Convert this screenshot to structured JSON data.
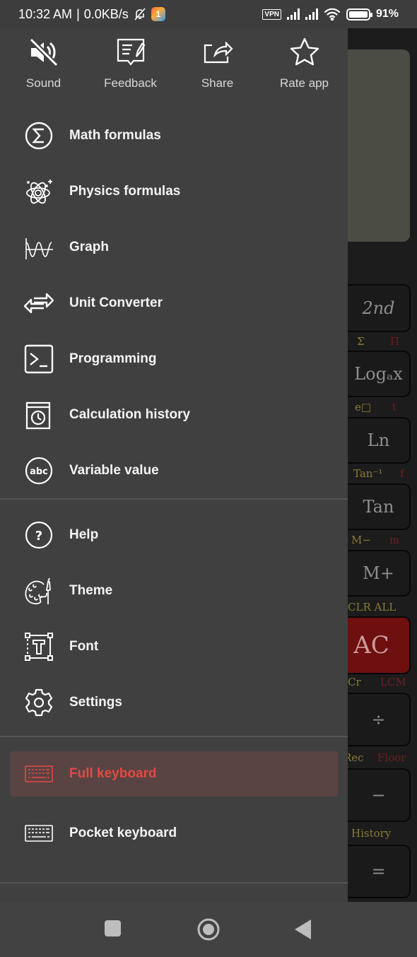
{
  "status_bar": {
    "time": "10:32 AM",
    "separator": "|",
    "network_speed": "0.0KB/s",
    "vpn_label": "VPN",
    "app_badge": "1",
    "battery": "91%",
    "icons": [
      "bell-off-icon",
      "app-notification-icon",
      "vpn-icon",
      "signal-icon",
      "signal-icon",
      "wifi-icon",
      "battery-icon"
    ]
  },
  "quick_actions": [
    {
      "label": "Sound",
      "icon": "sound-off-icon"
    },
    {
      "label": "Feedback",
      "icon": "feedback-icon"
    },
    {
      "label": "Share",
      "icon": "share-icon"
    },
    {
      "label": "Rate app",
      "icon": "star-icon"
    }
  ],
  "menu": {
    "tools": [
      {
        "label": "Math formulas",
        "icon": "sigma-icon"
      },
      {
        "label": "Physics formulas",
        "icon": "atom-icon"
      },
      {
        "label": "Graph",
        "icon": "graph-icon"
      },
      {
        "label": "Unit Converter",
        "icon": "swap-arrows-icon"
      },
      {
        "label": "Programming",
        "icon": "terminal-icon"
      },
      {
        "label": "Calculation history",
        "icon": "history-icon"
      },
      {
        "label": "Variable value",
        "icon": "abc-icon"
      }
    ],
    "settings": [
      {
        "label": "Help",
        "icon": "help-icon"
      },
      {
        "label": "Theme",
        "icon": "palette-icon"
      },
      {
        "label": "Font",
        "icon": "font-icon"
      },
      {
        "label": "Settings",
        "icon": "gear-icon"
      }
    ],
    "keyboards": [
      {
        "label": "Full keyboard",
        "icon": "keyboard-icon",
        "selected": true
      },
      {
        "label": "Pocket keyboard",
        "icon": "keyboard-icon",
        "selected": false
      }
    ]
  },
  "colors": {
    "drawer_bg": "#404040",
    "selected_bg": "#5a4343",
    "accent": "#e14a44"
  },
  "background_calculator": {
    "keys": [
      "2nd",
      "Logₐx",
      "Ln",
      "Tan",
      "M+",
      "AC",
      "÷",
      "−",
      "="
    ],
    "secondary_labels": [
      {
        "yellow": "Σ",
        "red": "Π"
      },
      {
        "yellow": "e□",
        "red": "t"
      },
      {
        "yellow": "Tan⁻¹",
        "red": "f"
      },
      {
        "yellow": "M−",
        "red": "m"
      },
      {
        "yellow": "CLR ALL",
        "red": ""
      },
      {
        "yellow": "Cr",
        "red": "LCM"
      },
      {
        "yellow": "Rec",
        "red": "Floor"
      },
      {
        "yellow": "History",
        "red": ""
      }
    ]
  },
  "nav_bar": {
    "buttons": [
      "recents-button",
      "home-button",
      "back-button"
    ]
  }
}
